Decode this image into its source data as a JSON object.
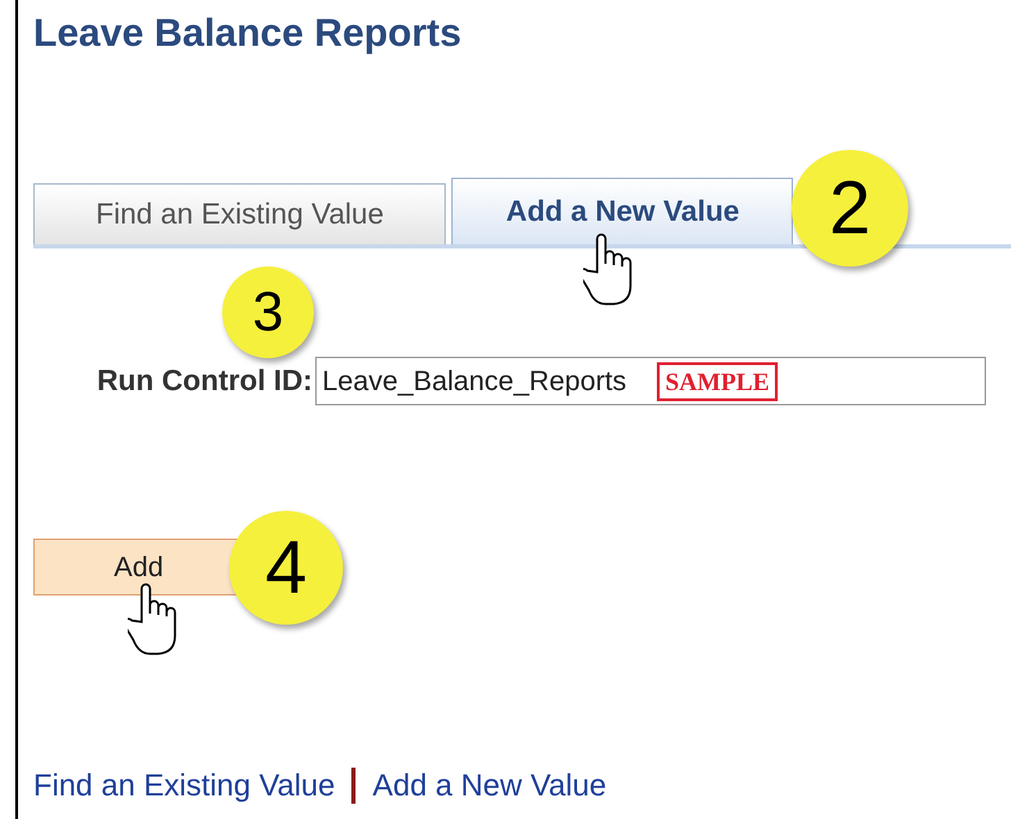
{
  "page": {
    "title": "Leave Balance Reports"
  },
  "tabs": [
    {
      "label": "Find an Existing Value",
      "selected": false
    },
    {
      "label": "Add a New Value",
      "selected": true
    }
  ],
  "form": {
    "label": "Run Control ID:",
    "value": "Leave_Balance_Reports",
    "stamp": "SAMPLE"
  },
  "add_button": "Add",
  "callouts": [
    {
      "number": "2"
    },
    {
      "number": "3"
    },
    {
      "number": "4"
    }
  ],
  "footer_links": [
    "Find an Existing Value",
    "Add a New Value"
  ]
}
